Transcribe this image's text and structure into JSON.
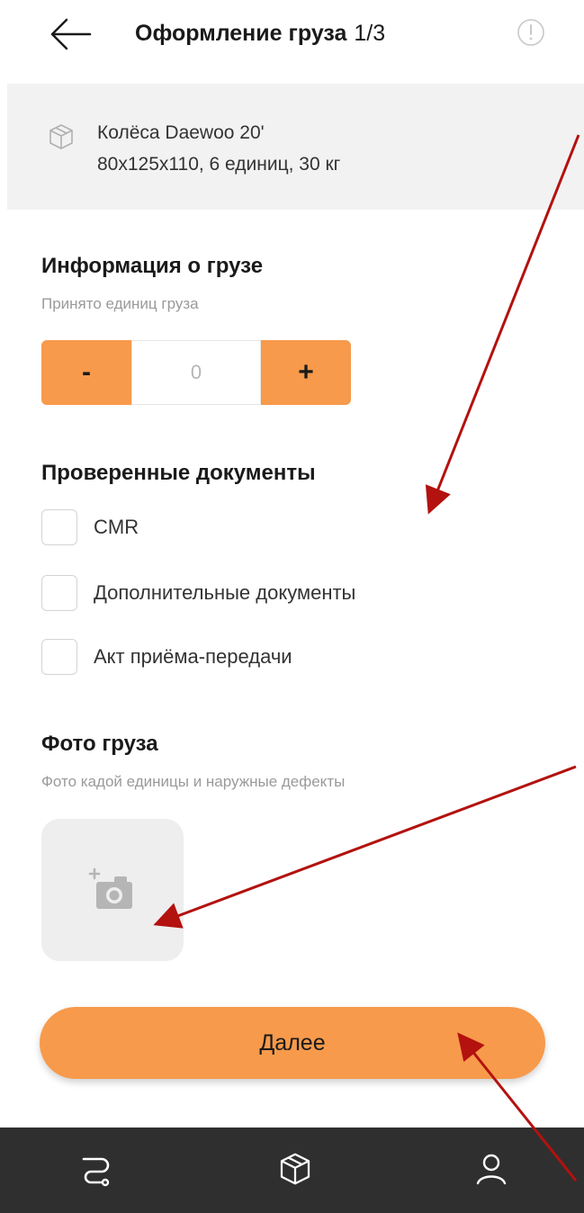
{
  "header": {
    "title": "Оформление груза",
    "step": "1/3",
    "back_icon": "arrow-left-icon",
    "info_icon": "info-icon"
  },
  "cargo": {
    "icon": "package-icon",
    "name": "Колёса Daewoo 20'",
    "details": "80x125x110, 6 единиц, 30 кг"
  },
  "cargo_info": {
    "title": "Информация о грузе",
    "subtitle": "Принято единиц груза",
    "stepper": {
      "minus_label": "-",
      "plus_label": "+",
      "value": "0"
    }
  },
  "documents": {
    "title": "Проверенные документы",
    "items": [
      {
        "label": "CMR",
        "checked": false
      },
      {
        "label": "Дополнительные документы",
        "checked": false
      },
      {
        "label": "Акт приёма-передачи",
        "checked": false
      }
    ]
  },
  "photos": {
    "title": "Фото груза",
    "subtitle": "Фото кадой единицы и наружные дефекты",
    "add_icon": "add-photo-camera-icon"
  },
  "next_button": {
    "label": "Далее"
  },
  "tabbar": {
    "items": [
      {
        "icon": "route-icon"
      },
      {
        "icon": "package-icon"
      },
      {
        "icon": "user-icon"
      }
    ]
  },
  "colors": {
    "accent": "#f79a4b",
    "tabbar": "#2f2f2f",
    "annotation_arrow": "#b3120f",
    "cargo_box": "#f2f2f2"
  }
}
